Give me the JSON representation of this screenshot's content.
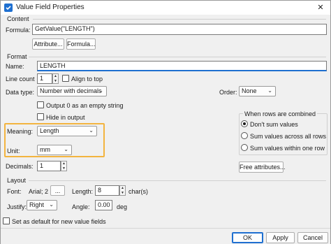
{
  "window": {
    "title": "Value Field Properties",
    "close_glyph": "✕"
  },
  "content": {
    "group_title": "Content",
    "formula_label": "Formula:",
    "formula_value": "GetValue(\"LENGTH\")",
    "attribute_button": "Attribute...",
    "formula_button": "Formula..."
  },
  "format": {
    "group_title": "Format",
    "name_label": "Name:",
    "name_value": "LENGTH",
    "line_count_label": "Line count",
    "line_count_value": "1",
    "align_to_top_label": "Align to top",
    "align_to_top_checked": false,
    "data_type_label": "Data type:",
    "data_type_value": "Number with decimals",
    "output_zero_label": "Output 0 as an empty string",
    "hide_in_output_label": "Hide in output",
    "meaning_label": "Meaning:",
    "meaning_value": "Length",
    "unit_label": "Unit:",
    "unit_value": "mm",
    "decimals_label": "Decimals:",
    "decimals_value": "1",
    "order_label": "Order:",
    "order_value": "None",
    "combine_group_title": "When rows are combined",
    "combine_options": [
      "Don't sum values",
      "Sum values across all rows",
      "Sum values within one row"
    ],
    "combine_selected": 0,
    "free_attributes_button": "Free attributes..."
  },
  "layout": {
    "group_title": "Layout",
    "font_label": "Font:",
    "font_value": "Arial; 2",
    "font_button": "...",
    "length_label": "Length:",
    "length_value": "8",
    "length_unit": "char(s)",
    "justify_label": "Justify:",
    "justify_value": "Right",
    "angle_label": "Angle:",
    "angle_value": "0.00",
    "angle_unit": "deg"
  },
  "footer": {
    "default_label": "Set as default for new value fields",
    "ok_button": "OK",
    "apply_button": "Apply",
    "cancel_button": "Cancel"
  },
  "colors": {
    "accent": "#1e6fd0",
    "highlight": "#f3b43f"
  }
}
